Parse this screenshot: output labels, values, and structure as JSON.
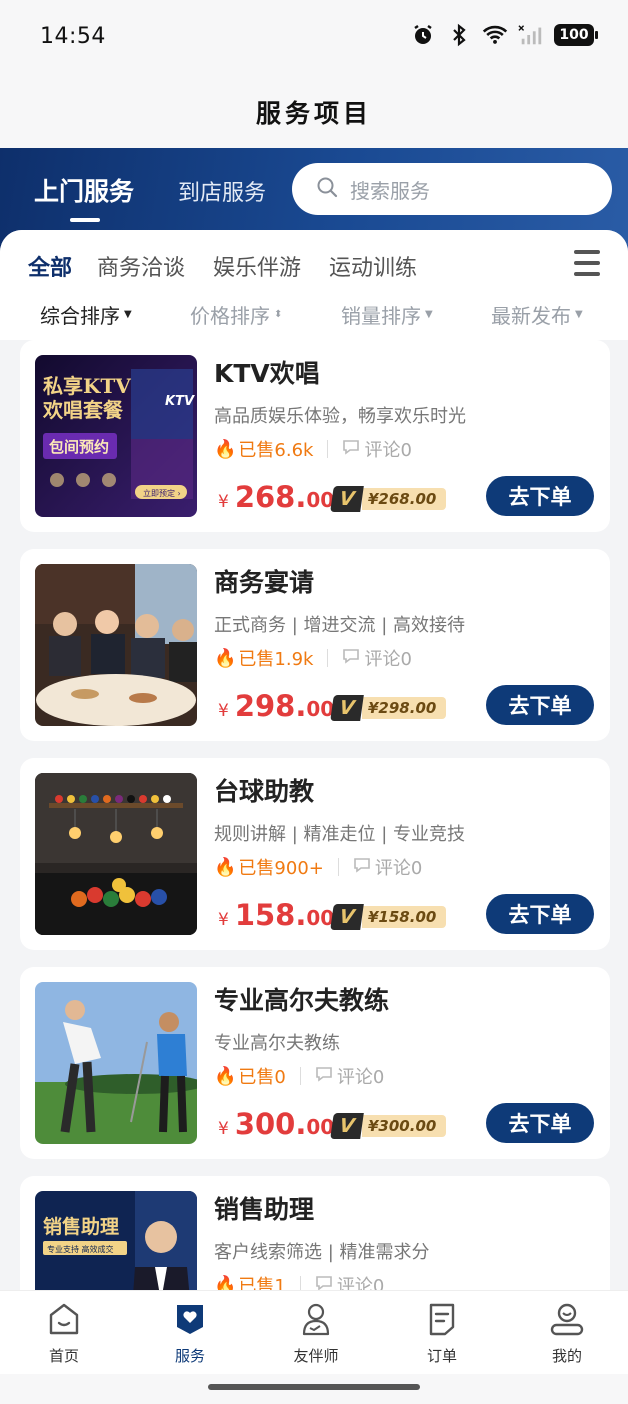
{
  "status_bar": {
    "time": "14:54",
    "battery": "100",
    "icons": [
      "alarm-icon",
      "bluetooth-icon",
      "wifi-icon",
      "signal-icon"
    ]
  },
  "page_title": "服务项目",
  "header": {
    "tabs": [
      {
        "label": "上门服务",
        "active": true
      },
      {
        "label": "到店服务",
        "active": false
      }
    ],
    "search_placeholder": "搜索服务"
  },
  "categories": [
    {
      "label": "全部",
      "active": true
    },
    {
      "label": "商务洽谈",
      "active": false
    },
    {
      "label": "娱乐伴游",
      "active": false
    },
    {
      "label": "运动训练",
      "active": false
    }
  ],
  "sorts": [
    {
      "label": "综合排序",
      "active": true
    },
    {
      "label": "价格排序",
      "active": false
    },
    {
      "label": "销量排序",
      "active": false
    },
    {
      "label": "最新发布",
      "active": false
    }
  ],
  "services": [
    {
      "name": "KTV欢唱",
      "desc": "高品质娱乐体验，畅享欢乐时光",
      "sold": "已售6.6k",
      "comments": "评论0",
      "price_int": "268.",
      "price_dec": "00",
      "currency": "¥",
      "vip_price": "¥268.00",
      "order_label": "去下单",
      "thumb_lines": [
        "私享KTV",
        "欢唱套餐",
        "包间预约"
      ],
      "thumb_badge": "KTV",
      "thumb_cta": "立即预定 ›"
    },
    {
      "name": "商务宴请",
      "desc": "正式商务 | 增进交流 | 高效接待",
      "sold": "已售1.9k",
      "comments": "评论0",
      "price_int": "298.",
      "price_dec": "00",
      "currency": "¥",
      "vip_price": "¥298.00",
      "order_label": "去下单"
    },
    {
      "name": "台球助教",
      "desc": "规则讲解 | 精准走位 | 专业竞技",
      "sold": "已售900+",
      "comments": "评论0",
      "price_int": "158.",
      "price_dec": "00",
      "currency": "¥",
      "vip_price": "¥158.00",
      "order_label": "去下单"
    },
    {
      "name": "专业高尔夫教练",
      "desc": "专业高尔夫教练",
      "sold": "已售0",
      "comments": "评论0",
      "price_int": "300.",
      "price_dec": "00",
      "currency": "¥",
      "vip_price": "¥300.00",
      "order_label": "去下单"
    },
    {
      "name": "销售助理",
      "desc": "客户线索筛选 | 精准需求分",
      "sold": "已售1",
      "comments": "评论0",
      "price_int": "",
      "price_dec": "",
      "currency": "",
      "vip_price": "",
      "order_label": "",
      "thumb_lines": [
        "销售助理",
        "专业支持 高效成交"
      ]
    }
  ],
  "nav": [
    {
      "label": "首页",
      "icon": "home-icon",
      "active": false
    },
    {
      "label": "服务",
      "icon": "service-heart-icon",
      "active": true
    },
    {
      "label": "友伴师",
      "icon": "companion-icon",
      "active": false
    },
    {
      "label": "订单",
      "icon": "order-icon",
      "active": false
    },
    {
      "label": "我的",
      "icon": "profile-icon",
      "active": false
    }
  ],
  "colors": {
    "brand_blue": "#0e3a78",
    "price_red": "#e23c3c",
    "sold_orange": "#f07a12"
  }
}
